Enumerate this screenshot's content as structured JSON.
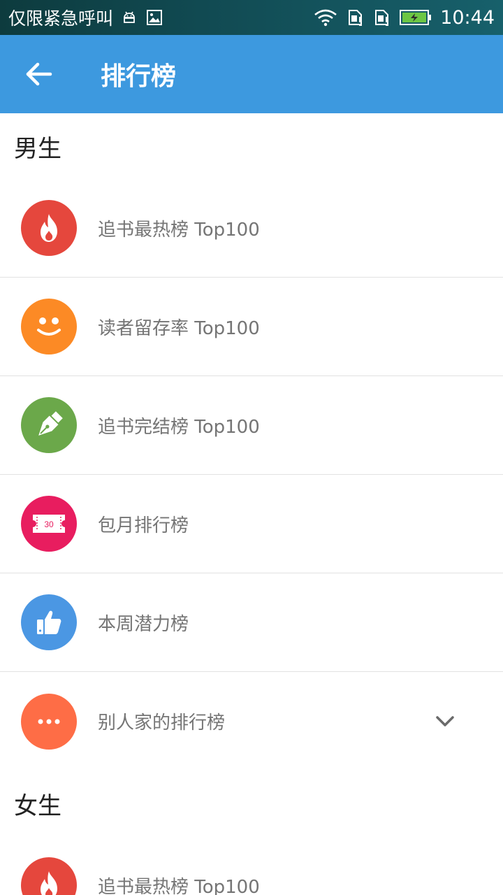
{
  "status_bar": {
    "carrier": "仅限紧急呼叫",
    "time": "10:44",
    "left_icons": [
      "android-debug-icon",
      "image-icon"
    ],
    "right_icons": [
      "wifi-icon",
      "sim-alert-icon",
      "sim-alert-icon",
      "battery-charging-icon"
    ]
  },
  "app_bar": {
    "title": "排行榜",
    "background": "#3d99df"
  },
  "sections": {
    "male": {
      "title": "男生",
      "items": [
        {
          "label": "追书最热榜 Top100",
          "icon": "flame-icon",
          "color": "#e5473d"
        },
        {
          "label": "读者留存率 Top100",
          "icon": "smiley-icon",
          "color": "#fc8a25"
        },
        {
          "label": "追书完结榜 Top100",
          "icon": "pen-nib-icon",
          "color": "#6ba84a"
        },
        {
          "label": "包月排行榜",
          "icon": "ticket-30-icon",
          "color": "#e81d5f",
          "ticket_text": "30"
        },
        {
          "label": "本周潜力榜",
          "icon": "thumbs-up-icon",
          "color": "#4b97e3"
        },
        {
          "label": "别人家的排行榜",
          "icon": "more-dots-icon",
          "color": "#fe6d46"
        }
      ]
    },
    "female": {
      "title": "女生",
      "items": [
        {
          "label": "追书最热榜 Top100",
          "icon": "flame-icon",
          "color": "#e5473d"
        }
      ]
    }
  }
}
